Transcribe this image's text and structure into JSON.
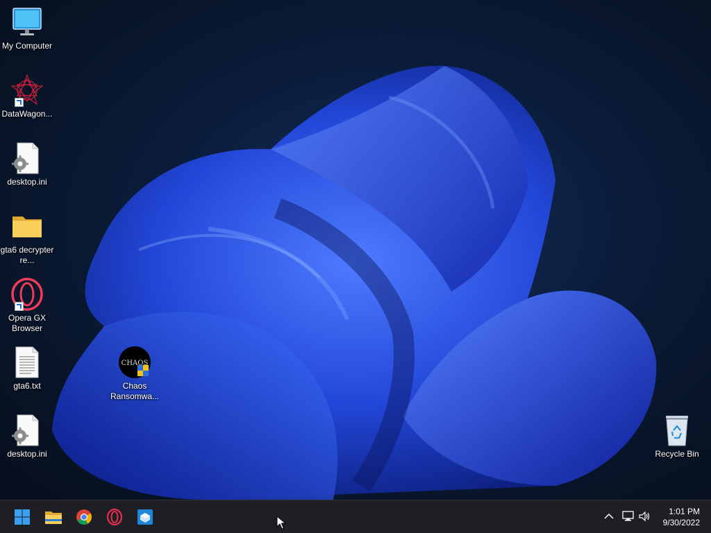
{
  "desktop": {
    "icons": [
      {
        "label": "My Computer",
        "icon": "monitor-icon"
      },
      {
        "label": "DataWagon...",
        "icon": "datawagon-shortcut-icon"
      },
      {
        "label": "desktop.ini",
        "icon": "settings-file-icon"
      },
      {
        "label": "gta6 decrypter re...",
        "icon": "folder-icon"
      },
      {
        "label": "Opera GX Browser",
        "icon": "opera-gx-icon"
      },
      {
        "label": "gta6.txt",
        "icon": "text-file-icon"
      },
      {
        "label": "desktop.ini",
        "icon": "settings-file-icon"
      },
      {
        "label": "Chaos Ransomwa...",
        "icon": "chaos-ransomware-icon",
        "logo_text": "CHAOS"
      },
      {
        "label": "Recycle Bin",
        "icon": "recycle-bin-icon"
      }
    ]
  },
  "taskbar": {
    "apps": [
      {
        "name": "start",
        "icon": "windows-start-icon"
      },
      {
        "name": "file-explorer",
        "icon": "file-explorer-icon"
      },
      {
        "name": "chrome",
        "icon": "chrome-icon"
      },
      {
        "name": "opera",
        "icon": "opera-icon"
      },
      {
        "name": "app",
        "icon": "box-app-icon"
      }
    ],
    "tray": {
      "time": "1:01 PM",
      "date": "9/30/2022"
    }
  },
  "colors": {
    "taskbar_bg": "#1d1f24",
    "wallpaper_accent": "#2a5cf0",
    "desktop_bg": "#081427"
  }
}
